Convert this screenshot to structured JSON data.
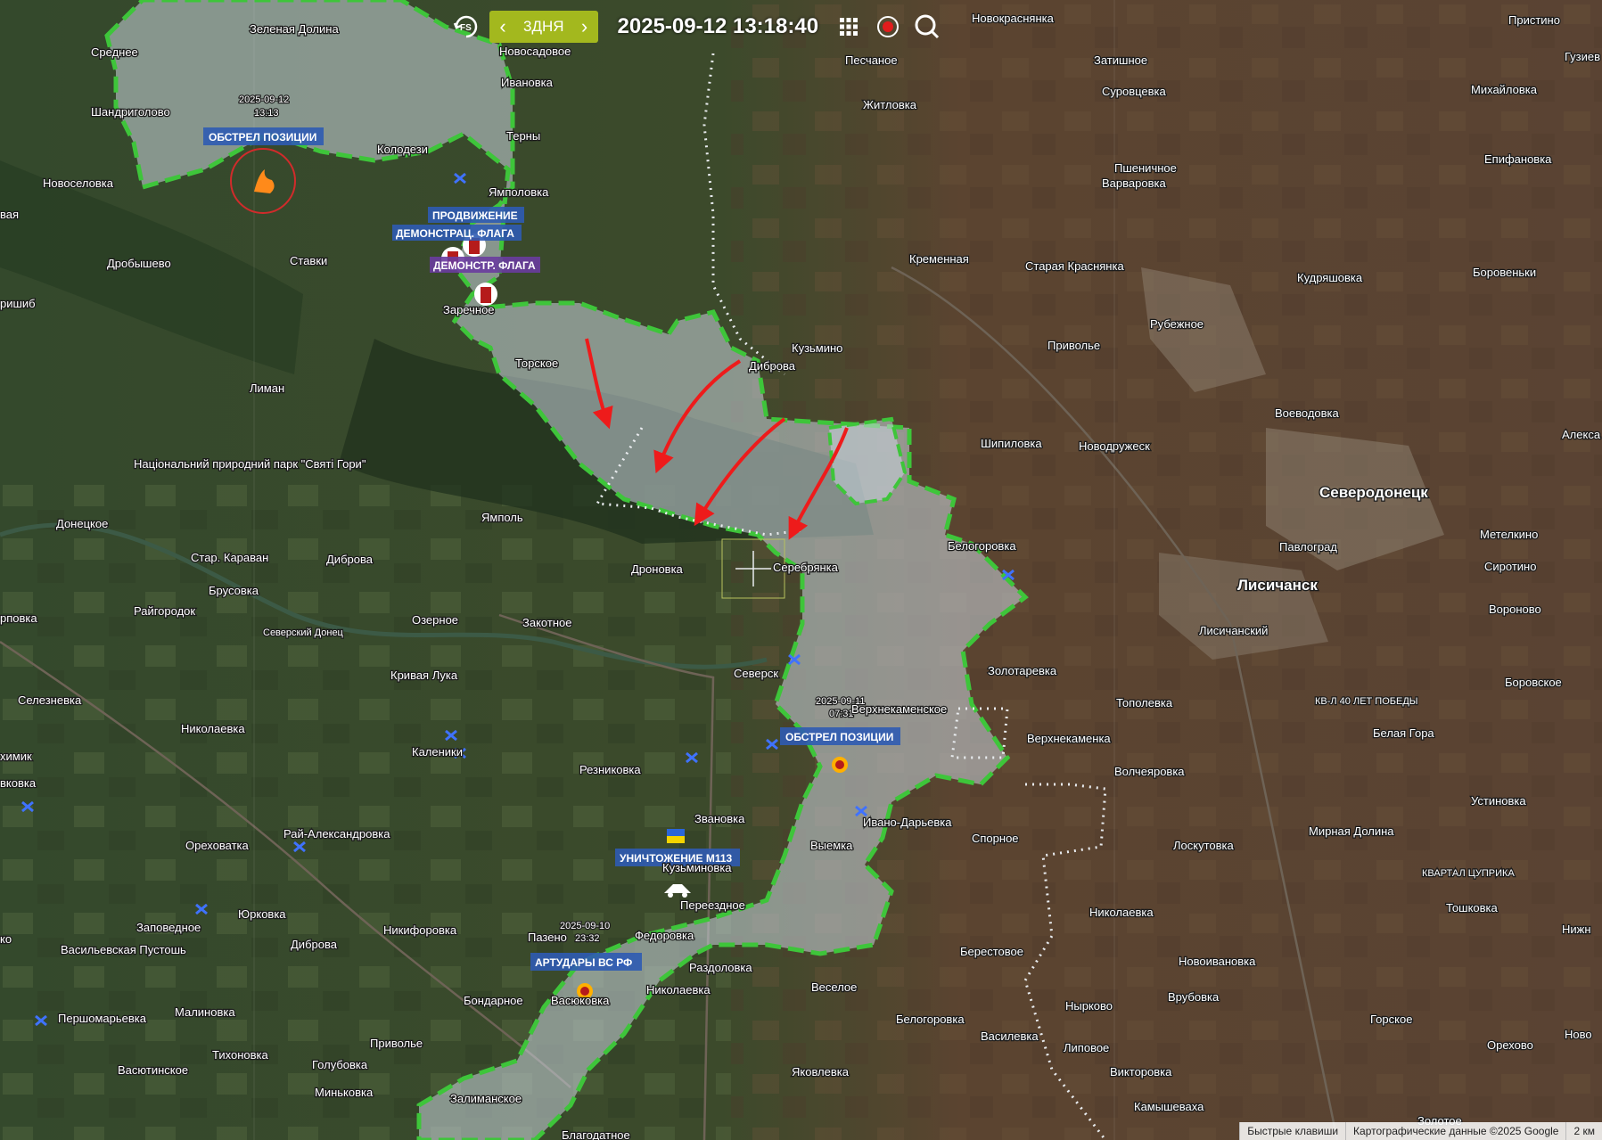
{
  "toolbar": {
    "fs_label": "FS",
    "range_label": "3ДНЯ",
    "prev_symbol": "‹",
    "next_symbol": "›",
    "timestamp": "2025-09-12 13:18:40",
    "icons": [
      "refresh-fs-icon",
      "grid-icon",
      "record-icon",
      "search-icon"
    ]
  },
  "colors": {
    "ru_border": "#3ec53a",
    "ru_fill": "#c8d3de",
    "dotted_line": "#e9ecef",
    "arrow": "#ee1b1b",
    "range_button": "#a3b81e",
    "label_bg": "#2f5bb3"
  },
  "places": {
    "srednee": "Среднее",
    "zelenaya_dolina": "Зеленая Долина",
    "novosadovoe": "Новосадовое",
    "novokrasnyanka": "Новокраснянка",
    "pristino": "Пристино",
    "guzievka": "Гузиев",
    "shandrigolovo": "Шандриголово",
    "ivanovka": "Ивановка",
    "peschanoe": "Песчаное",
    "zatishnoe": "Затишное",
    "surovtsevka": "Суровцевка",
    "mikhaylovka": "Михайловка",
    "zhitlovka": "Житловка",
    "terny": "Терны",
    "kolodezi": "Колодези",
    "novoselovka": "Новоселовка",
    "pshenichnoe": "Пшеничное",
    "epifanovka": "Епифановка",
    "varvarovka": "Варваровка",
    "yampolovka": "Ямполовка",
    "dva": "вая",
    "drobyshevo": "Дробышево",
    "stavki": "Ставки",
    "kremennaya": "Кременная",
    "staraya_krasnyanka": "Старая Краснянка",
    "kudryashovka": "Кудряшовка",
    "borovenki": "Боровеньки",
    "rishib": "ришиб",
    "zarechnoe": "Заречное",
    "rubezhnoe": "Рубежное",
    "kuzmino": "Кузьмино",
    "privolye": "Приволье",
    "torskoe": "Торское",
    "dibrova": "Диброва",
    "liman": "Лиман",
    "voevodovka": "Воеводовка",
    "shipilovka": "Шипиловка",
    "novodruzhesk": "Новодружеск",
    "aleksandr": "Алекса",
    "park": "Національний природний парк \"Святі Гори\"",
    "severodonetsk": "Северодонецк",
    "yampol": "Ямполь",
    "donetskoe": "Донецкое",
    "belogorovka": "Белогоровка",
    "metelkino": "Метелкино",
    "pavlograd": "Павлоград",
    "star_karavan": "Стар. Караван",
    "dibrova2": "Диброва",
    "serebryanka": "Серебрянка",
    "dronovka": "Дроновка",
    "sirotino": "Сиротино",
    "brusovka": "Брусовка",
    "lisichansk": "Лисичанск",
    "raygorodok": "Райгородок",
    "ozernoe": "Озерное",
    "zakotnoe": "Закотное",
    "lisichanskiy": "Лисичанский",
    "voronovo": "Вороново",
    "rpovka": "рповка",
    "severskiy_donets": "Северский Донец",
    "krivaya_luka": "Кривая Лука",
    "seversk": "Северск",
    "zolotarevka": "Золотаревка",
    "borovskoe": "Боровское",
    "seleznevka": "Селезневка",
    "verkhnekamenskoe": "Верхнекаменское",
    "topolevka": "Тополевка",
    "kvartal_40": "КВ-Л 40 ЛЕТ ПОБЕДЫ",
    "nikolaevka": "Николаевка",
    "verkhnekamenka": "Верхнекаменка",
    "belaya_gora": "Белая Гора",
    "khimik": "химик",
    "kaleniki": "Каленики",
    "reznikovka": "Резниковка",
    "volcheyarovka": "Волчеяровка",
    "ustinovka": "Устиновка",
    "vkovka": "вковка",
    "ray_aleksandrovka": "Рай-Александровка",
    "ivano_daryevka": "Ивано-Дарьевка",
    "zvanovka": "Звановка",
    "vyemka": "Выемка",
    "spornoe": "Спорное",
    "loskutovka": "Лоскутовка",
    "mirnaya_dolina": "Мирная Долина",
    "orekhovatka": "Ореховатка",
    "kuzminovka": "Кузьминовка",
    "kvartal_tsuprika": "КВАРТАЛ ЦУПРИКА",
    "zapovednoe": "Заповедное",
    "yurkovka": "Юрковка",
    "pereezdnoe": "Переездное",
    "tashkovka": "Тошковка",
    "nizh": "Нижн",
    "nikolaevka2": "Николаевка",
    "ko": "ко",
    "nikiforovka": "Никифоровка",
    "pazeno": "Пазено",
    "fedorovka": "Федоровка",
    "vasilevskaya_pustosh": "Васильевская Пустошь",
    "dibrova3": "Диброва",
    "berestovoe": "Берестовое",
    "razdolovka": "Раздоловка",
    "novoivanovka": "Новоивановка",
    "bondarnoe": "Бондарное",
    "nikolaevka3": "Николаевка",
    "veseloe": "Веселое",
    "vrubovka": "Врубовка",
    "pershomaryevka": "Першомарьевка",
    "malinovka": "Малиновка",
    "vasyukovka": "Васюковка",
    "belogorovka2": "Белогоровка",
    "nyrkovo": "Нырково",
    "gorskoe": "Горское",
    "orekhovo": "Орехово",
    "novoto": "Ново",
    "tikhonovka": "Тихоновка",
    "privolye2": "Приволье",
    "vasilevka": "Василевка",
    "lipovoe": "Липовое",
    "vasyutinskoe": "Васютинское",
    "golubovka": "Голубовка",
    "minkovka": "Миньковка",
    "yakovlevka": "Яковлевка",
    "viktorovka": "Викторовка",
    "zaliznyanskoe": "Залиманское",
    "kamyshevakha": "Камышеваха",
    "blagodatnoe": "Благодатное",
    "zolotoe": "Золотое"
  },
  "events": [
    {
      "label": "ОБСТРЕЛ ПОЗИЦИИ",
      "date": "2025-09-12",
      "time": "13:13"
    },
    {
      "label": "ПРОДВИЖЕНИЕ"
    },
    {
      "label": "ДЕМОНСТРАЦ. ФЛАГА"
    },
    {
      "label": "ДЕМОНСТР. ФЛАГА"
    },
    {
      "label": "ОБСТРЕЛ ПОЗИЦИИ",
      "date": "2025-09-11",
      "time": "07:31"
    },
    {
      "label": "УНИЧТОЖЕНИЕ М113"
    },
    {
      "label": "АРТУДАРЫ ВС РФ",
      "date": "2025-09-10",
      "time": "23:32"
    }
  ],
  "attribution": {
    "shortcuts": "Быстрые клавиши",
    "map_data": "Картографические данные ©2025 Google",
    "scale": "2 км"
  }
}
